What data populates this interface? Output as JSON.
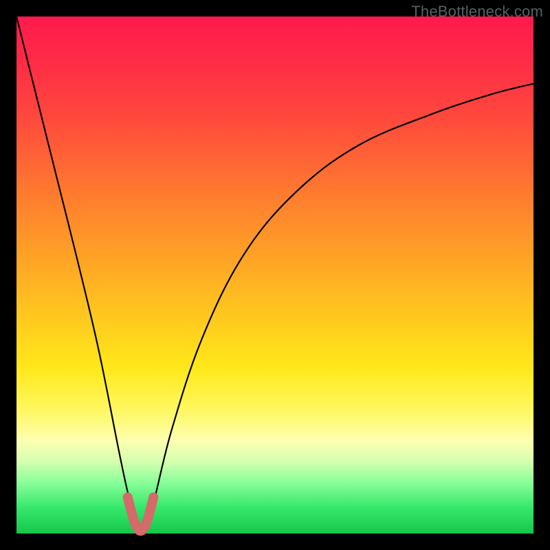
{
  "watermark": "TheBottleneck.com",
  "chart_data": {
    "type": "line",
    "title": "",
    "xlabel": "",
    "ylabel": "",
    "xlim": [
      0,
      100
    ],
    "ylim": [
      0,
      100
    ],
    "grid": false,
    "legend": false,
    "series": [
      {
        "name": "bottleneck-curve",
        "x": [
          0,
          4,
          8,
          12,
          16,
          20,
          22,
          24,
          26,
          30,
          36,
          44,
          54,
          66,
          80,
          92,
          100
        ],
        "values": [
          100,
          84,
          68,
          52,
          35,
          15,
          6,
          0,
          4,
          20,
          38,
          54,
          66,
          75,
          81,
          85,
          87
        ]
      },
      {
        "name": "highlighted-minimum",
        "x": [
          21.5,
          22.8,
          24.0,
          25.2,
          26.5
        ],
        "values": [
          7.0,
          2.3,
          0.5,
          2.3,
          7.0
        ]
      }
    ],
    "background_gradient": {
      "orientation": "vertical",
      "stops": [
        {
          "pos": 0.0,
          "color": "#ff1a4d"
        },
        {
          "pos": 0.34,
          "color": "#ff7a2f"
        },
        {
          "pos": 0.68,
          "color": "#ffe81a"
        },
        {
          "pos": 0.9,
          "color": "#8cff9a"
        },
        {
          "pos": 1.0,
          "color": "#17c64b"
        }
      ]
    },
    "annotations": [
      {
        "text": "TheBottleneck.com",
        "role": "watermark",
        "position": "top-right"
      }
    ]
  }
}
